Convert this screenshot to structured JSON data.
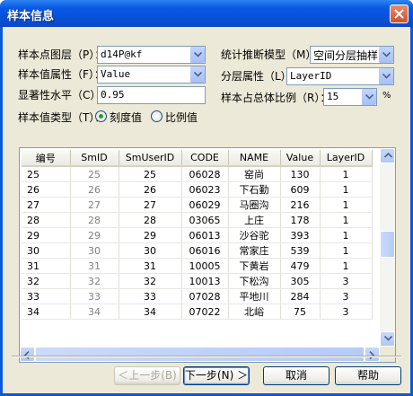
{
  "window": {
    "title": "样本信息"
  },
  "form": {
    "sample_layer_label": "样本点图层（P）：",
    "sample_layer_value": "d14P@kf",
    "sample_field_label": "样本值属性（F）：",
    "sample_field_value": "Value",
    "significance_label": "显著性水平（C）：",
    "significance_value": "0.95",
    "sample_type_label": "样本值类型（T）：",
    "radio_scale_label": "刻度值",
    "radio_ratio_label": "比例值",
    "model_label": "统计推断模型（M）：",
    "model_value": "空间分层抽样",
    "layer_attr_label": "分层属性（L）：",
    "layer_attr_value": "LayerID",
    "ratio_label": "样本占总体比例（R）：",
    "ratio_value": "15",
    "ratio_unit": "%"
  },
  "table": {
    "columns": [
      "编号",
      "SmID",
      "SmUserID",
      "CODE",
      "NAME",
      "Value",
      "LayerID"
    ],
    "rows": [
      [
        "25",
        "25",
        "25",
        "06028",
        "窑尚",
        "130",
        "1"
      ],
      [
        "26",
        "26",
        "26",
        "06023",
        "下石勤",
        "609",
        "1"
      ],
      [
        "27",
        "27",
        "27",
        "06029",
        "马圈沟",
        "216",
        "1"
      ],
      [
        "28",
        "28",
        "28",
        "03065",
        "上庄",
        "178",
        "1"
      ],
      [
        "29",
        "29",
        "29",
        "06013",
        "沙谷驼",
        "393",
        "1"
      ],
      [
        "30",
        "30",
        "30",
        "06016",
        "常家庄",
        "539",
        "1"
      ],
      [
        "31",
        "31",
        "31",
        "10005",
        "下黄岩",
        "479",
        "1"
      ],
      [
        "32",
        "32",
        "32",
        "10013",
        "下松沟",
        "305",
        "3"
      ],
      [
        "33",
        "33",
        "33",
        "07028",
        "平地川",
        "284",
        "3"
      ],
      [
        "34",
        "34",
        "34",
        "07022",
        "北峪",
        "75",
        "3"
      ]
    ]
  },
  "buttons": {
    "back": "＜上一步(B)",
    "next": "下一步(N) ＞",
    "cancel": "取消",
    "help": "帮助"
  }
}
